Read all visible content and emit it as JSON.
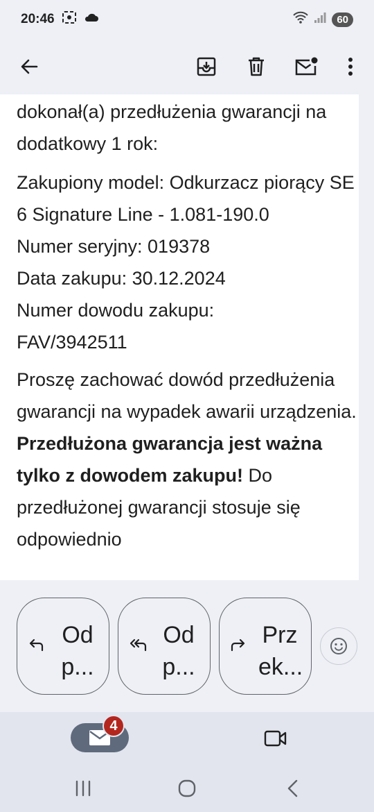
{
  "status_bar": {
    "time": "20:46",
    "battery": "60",
    "icons": [
      "screenshot-icon",
      "cloud-icon",
      "wifi-icon",
      "signal-icon"
    ]
  },
  "toolbar": {
    "icons": [
      "back-arrow-icon",
      "archive-icon",
      "trash-icon",
      "mark-unread-icon",
      "more-vert-icon"
    ]
  },
  "email": {
    "p1": "dokonał(a) przedłużenia gwarancji na dodatkowy 1 rok:",
    "model_line": "Zakupiony model: Odkurzacz piorący SE 6 Signature Line - 1.081-190.0",
    "serial_line": "Numer seryjny: 019378",
    "date_line": "Data zakupu: 30.12.2024",
    "proof_label": "Numer dowodu zakupu:",
    "proof_value": "FAV/3942511",
    "p3_start": "Proszę zachować dowód przedłużenia gwarancji na wypadek awarii urządzenia. ",
    "p3_bold": "Przedłużona gwarancja jest ważna tylko z dowodem zakupu!",
    "p3_end": " Do przedłużonej gwarancji stosuje się odpowiednio"
  },
  "reply_bar": {
    "reply_label": "Od p...",
    "reply_all_label": "Od p...",
    "forward_label": "Prz ek..."
  },
  "bottom_nav": {
    "mail_badge": "4"
  },
  "colors": {
    "background": "#eef0f6",
    "paper": "#ffffff",
    "nav": "#e2e5ee",
    "badge": "#b3261e",
    "pill": "#5f6a7c"
  }
}
